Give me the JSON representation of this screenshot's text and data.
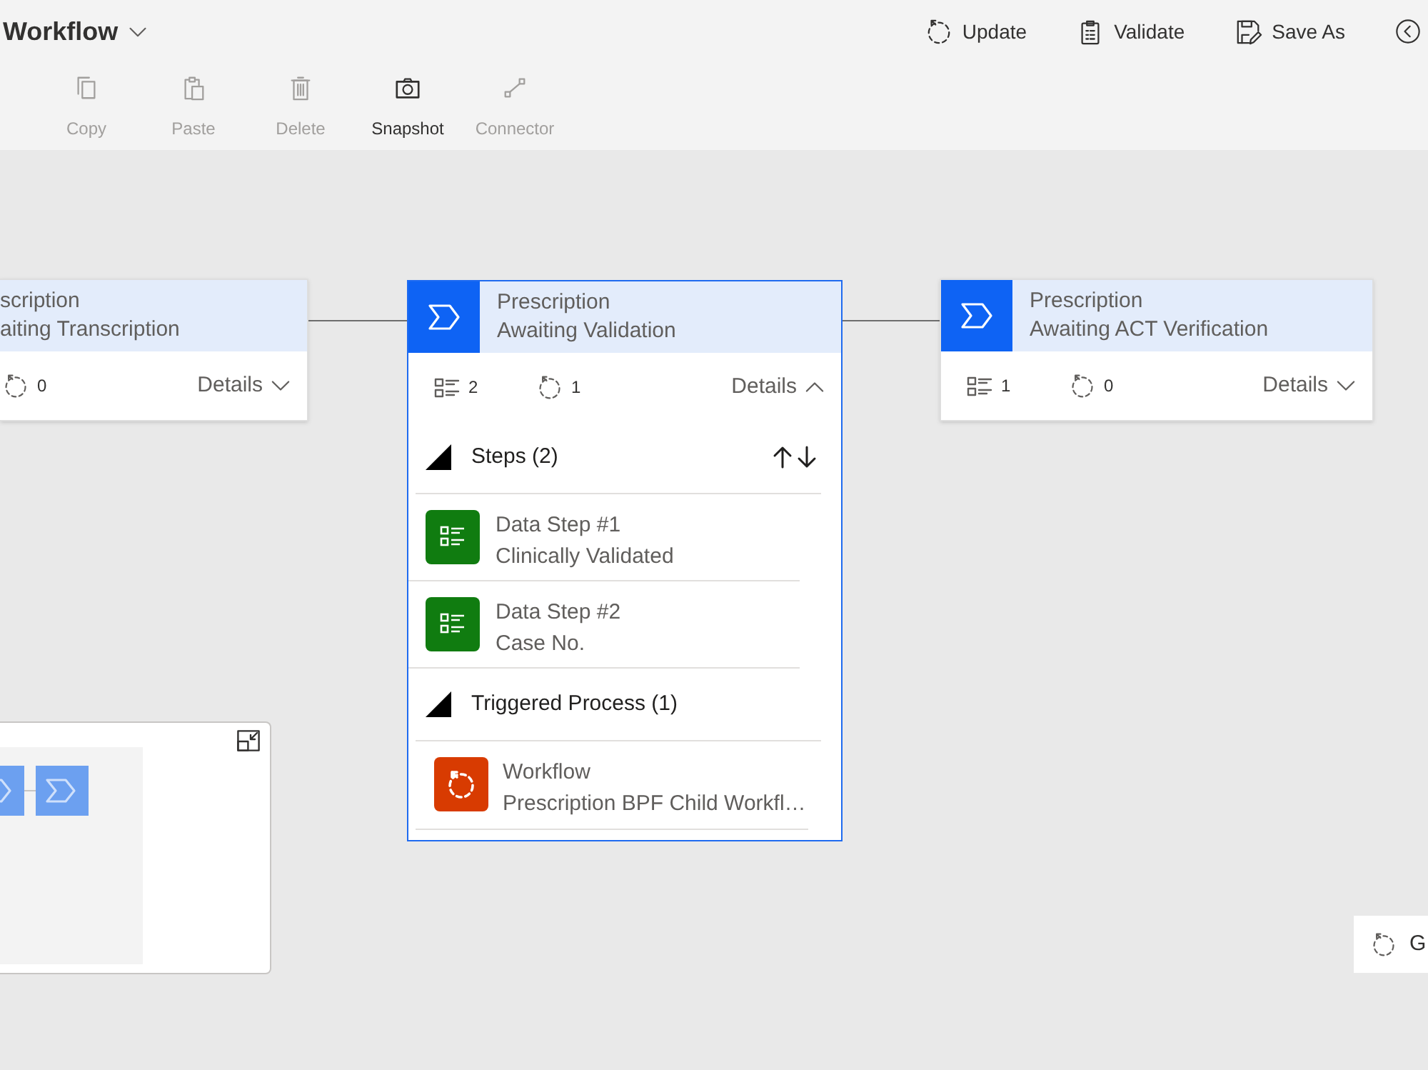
{
  "header": {
    "title": "Workflow",
    "actions": [
      {
        "label": "Update"
      },
      {
        "label": "Validate"
      },
      {
        "label": "Save As"
      }
    ]
  },
  "toolbar": [
    {
      "label": "Copy",
      "disabled": true
    },
    {
      "label": "Paste",
      "disabled": true
    },
    {
      "label": "Delete",
      "disabled": true
    },
    {
      "label": "Snapshot",
      "disabled": false
    },
    {
      "label": "Connector",
      "disabled": true
    }
  ],
  "canvas": {
    "stages": [
      {
        "title": "scription",
        "subtitle": "aiting Transcription",
        "process_count": "0",
        "details_label": "Details",
        "expanded": false,
        "selected": false
      },
      {
        "title": "Prescription",
        "subtitle": "Awaiting Validation",
        "step_count": "2",
        "process_count": "1",
        "details_label": "Details",
        "expanded": true,
        "selected": true,
        "sections": [
          {
            "kind": "steps",
            "title": "Steps (2)",
            "items": [
              {
                "kind": "data_step",
                "title": "Data Step #1",
                "subtitle": "Clinically Validated"
              },
              {
                "kind": "data_step",
                "title": "Data Step #2",
                "subtitle": "Case No."
              }
            ]
          },
          {
            "kind": "processes",
            "title": "Triggered Process (1)",
            "items": [
              {
                "kind": "workflow",
                "title": "Workflow",
                "subtitle": "Prescription BPF Child Workfl…"
              }
            ]
          }
        ]
      },
      {
        "title": "Prescription",
        "subtitle": "Awaiting ACT Verification",
        "step_count": "1",
        "process_count": "0",
        "details_label": "Details",
        "expanded": false,
        "selected": false
      }
    ],
    "corner_button": {
      "label": "G"
    }
  }
}
